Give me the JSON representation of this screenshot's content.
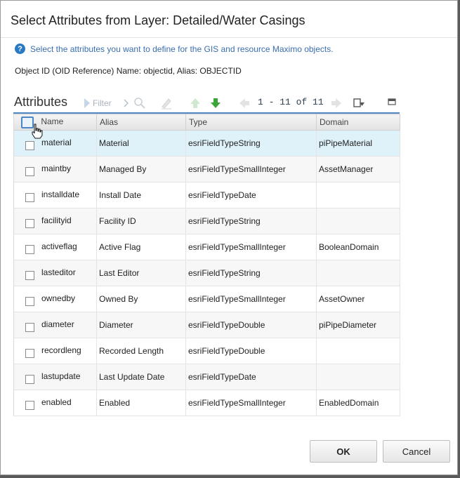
{
  "dialog": {
    "title": "Select Attributes from Layer: Detailed/Water Casings",
    "info_text": "Select the attributes you want to define for the GIS and resource Maximo objects.",
    "oid_text": "Object ID (OID Reference) Name: objectid, Alias: OBJECTID"
  },
  "toolbar": {
    "title": "Attributes",
    "filter_label": "Filter",
    "pager_text": "1 - 11 of 11"
  },
  "table": {
    "headers": {
      "name": "Name",
      "alias": "Alias",
      "type": "Type",
      "domain": "Domain"
    },
    "rows": [
      {
        "name": "material",
        "alias": "Material",
        "type": "esriFieldTypeString",
        "domain": "piPipeMaterial"
      },
      {
        "name": "maintby",
        "alias": "Managed By",
        "type": "esriFieldTypeSmallInteger",
        "domain": "AssetManager"
      },
      {
        "name": "installdate",
        "alias": "Install Date",
        "type": "esriFieldTypeDate",
        "domain": ""
      },
      {
        "name": "facilityid",
        "alias": "Facility ID",
        "type": "esriFieldTypeString",
        "domain": ""
      },
      {
        "name": "activeflag",
        "alias": "Active Flag",
        "type": "esriFieldTypeSmallInteger",
        "domain": "BooleanDomain"
      },
      {
        "name": "lasteditor",
        "alias": "Last Editor",
        "type": "esriFieldTypeString",
        "domain": ""
      },
      {
        "name": "ownedby",
        "alias": "Owned By",
        "type": "esriFieldTypeSmallInteger",
        "domain": "AssetOwner"
      },
      {
        "name": "diameter",
        "alias": "Diameter",
        "type": "esriFieldTypeDouble",
        "domain": "piPipeDiameter"
      },
      {
        "name": "recordleng",
        "alias": "Recorded Length",
        "type": "esriFieldTypeDouble",
        "domain": ""
      },
      {
        "name": "lastupdate",
        "alias": "Last Update Date",
        "type": "esriFieldTypeDate",
        "domain": ""
      },
      {
        "name": "enabled",
        "alias": "Enabled",
        "type": "esriFieldTypeSmallInteger",
        "domain": "EnabledDomain"
      }
    ]
  },
  "buttons": {
    "ok": "OK",
    "cancel": "Cancel"
  },
  "icons": {
    "help": "help-icon",
    "filter": "filter-arrow-icon",
    "search": "search-icon",
    "clear": "clear-filter-icon",
    "up": "arrow-up-icon",
    "down": "arrow-down-icon",
    "prev": "prev-page-icon",
    "next": "next-page-icon",
    "download": "download-icon",
    "collapse": "collapse-icon",
    "cursor": "hand-cursor-icon"
  },
  "colors": {
    "accent": "#4e86c2",
    "selected_row": "#dff2f9",
    "link_text": "#3a6fb0",
    "green_arrow": "#3aa63a"
  }
}
